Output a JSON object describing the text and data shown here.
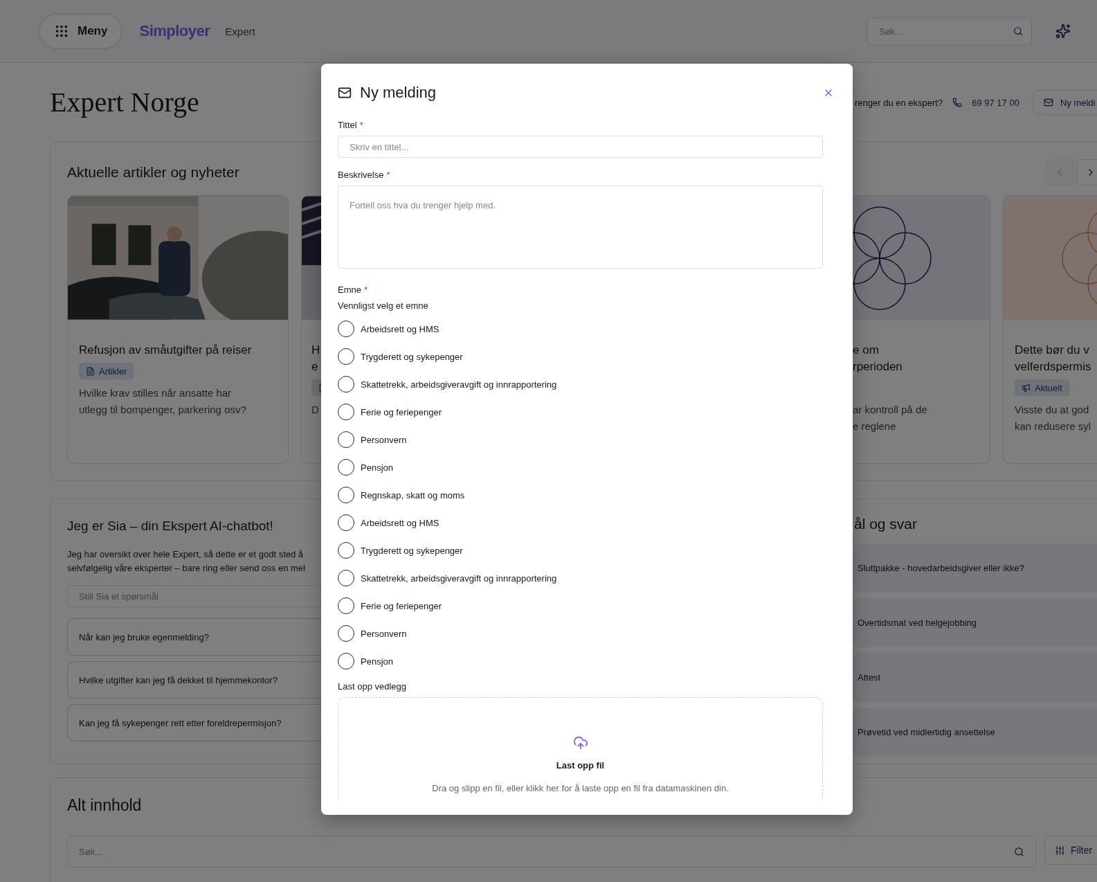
{
  "header": {
    "menu_label": "Meny",
    "logo": "Simployer",
    "product": "Expert",
    "search_placeholder": "Søk..."
  },
  "page_title": "Expert Norge",
  "contact": {
    "prompt": "renger du en ekspert?",
    "phone": "69 97 17 00",
    "button": "Ny meldi"
  },
  "articles": {
    "title": "Aktuelle artikler og nyheter",
    "nav": [
      {
        "kind": "prev",
        "disabled": true
      },
      {
        "kind": "next",
        "disabled": false
      }
    ],
    "cards": [
      {
        "title_lines": [
          "Refusjon av småutgifter på reiser"
        ],
        "tag": {
          "kind": "article",
          "label": "Artikler"
        },
        "text_lines": [
          "Hvilke krav stilles når ansatte har",
          "utlegg til bompenger, parkering osv?"
        ]
      },
      {
        "title_lines": [
          "H",
          "e"
        ],
        "tag": {
          "kind": "article"
        },
        "text_lines": [
          "D"
        ]
      },
      {
        "kind": "circles",
        "title_lines": [
          "e om",
          "rperioden"
        ],
        "text_lines": [
          "ar kontroll på de",
          "e reglene"
        ]
      },
      {
        "kind": "circles",
        "title_lines": [
          "Dette bør du v",
          "velferdspermis"
        ],
        "tag": {
          "kind": "news",
          "label": "Aktuelt"
        },
        "text_lines": [
          "Visste du at god",
          "kan redusere syl"
        ]
      }
    ]
  },
  "chatbot": {
    "title": "Jeg er Sia – din Ekspert AI-chatbot!",
    "text_lines": [
      "Jeg har oversikt over hele Expert, så dette er et godt sted å",
      "selvfølgelig våre eksperter – bare ring eller send oss en mel"
    ],
    "placeholder": "Still Sia et spørsmål",
    "suggestions": [
      "Når kan jeg bruke egenmelding?",
      "Hvilke utgifter kan jeg få dekket til hjemmekontor?",
      "Kan jeg få sykepenger rett etter foreldrepermisjon?"
    ]
  },
  "faq": {
    "title": "ål og svar",
    "items": [
      "Sluttpakke - hovedarbeidsgiver eller ikke?",
      "Overtidsmat ved helgejobbing",
      "Attest",
      "Prøvetid ved midlertidig ansettelse"
    ]
  },
  "all_content": {
    "title": "Alt innhold",
    "search_placeholder": "Søk...",
    "filter": "Filter"
  },
  "modal": {
    "title": "Ny melding",
    "required_mark": "*",
    "fields": [
      {
        "kind": "input",
        "label": "Tittel",
        "required": true,
        "placeholder": "Skriv en tittel..."
      },
      {
        "kind": "textarea",
        "label": "Beskrivelse",
        "required": true,
        "placeholder": "Fortell oss hva du trenger hjelp med."
      }
    ],
    "topic": {
      "label": "Emne",
      "required": true,
      "hint": "Vennligst velg et emne",
      "options": [
        {
          "label": "Arbeidsrett og HMS",
          "selected": false
        },
        {
          "label": "Trygderett og sykepenger",
          "selected": false
        },
        {
          "label": "Skattetrekk, arbeidsgiveravgift og innrapportering",
          "selected": false
        },
        {
          "label": "Ferie og feriepenger",
          "selected": false
        },
        {
          "label": "Personvern",
          "selected": false
        },
        {
          "label": "Pensjon",
          "selected": false
        },
        {
          "label": "Regnskap, skatt og moms",
          "selected": false
        },
        {
          "label": "Arbeidsrett og HMS",
          "selected": false
        },
        {
          "label": "Trygderett og sykepenger",
          "selected": false
        },
        {
          "label": "Skattetrekk, arbeidsgiveravgift og innrapportering",
          "selected": false
        },
        {
          "label": "Ferie og feriepenger",
          "selected": false
        },
        {
          "label": "Personvern",
          "selected": false
        },
        {
          "label": "Pensjon",
          "selected": false
        }
      ]
    },
    "upload": {
      "label": "Last opp vedlegg",
      "title": "Last opp fil",
      "text": "Dra og slipp en fil, eller klikk her for å laste opp en fil fra datamaskinen din."
    }
  }
}
